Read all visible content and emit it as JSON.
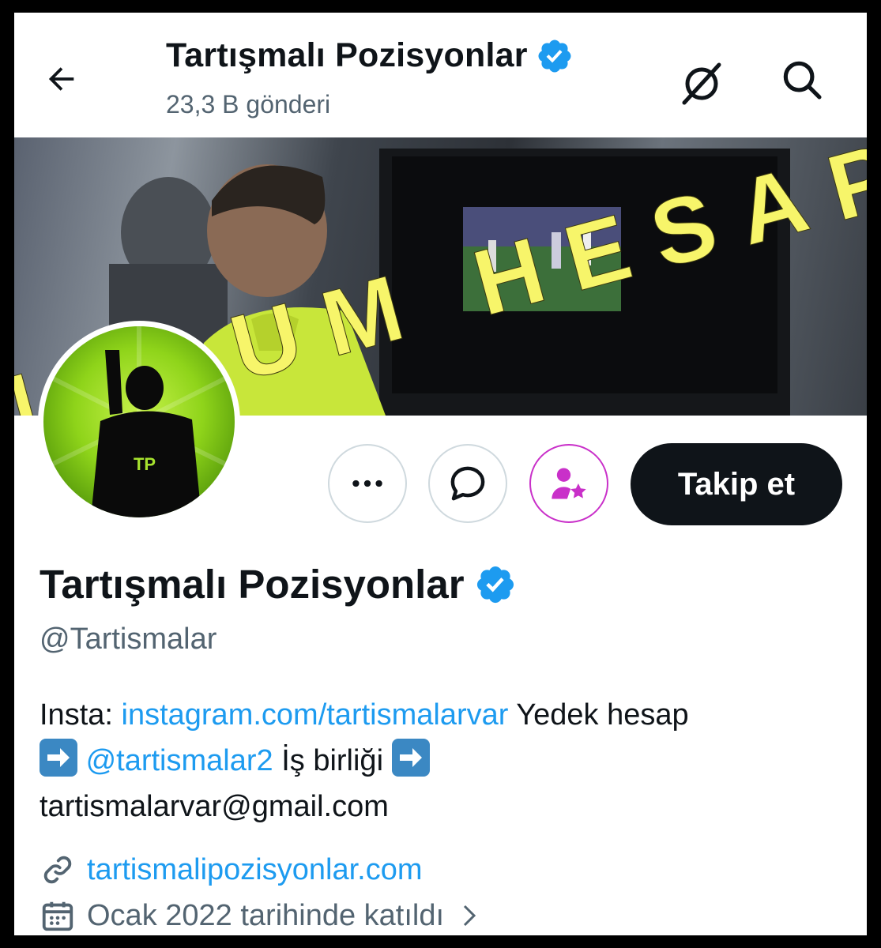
{
  "header": {
    "title": "Tartışmalı Pozisyonlar",
    "post_count": "23,3 B gönderi",
    "back_icon": "arrow-left-icon",
    "grok_icon": "grok-icon",
    "search_icon": "search-icon"
  },
  "banner": {
    "overlay_text": "MALUM HESAP",
    "overlay_color": "#f7f56a"
  },
  "avatar": {
    "logo_text": "TP"
  },
  "actions": {
    "more_icon": "more-icon",
    "message_icon": "message-icon",
    "subscribe_icon": "subscribe-icon",
    "follow_label": "Takip et"
  },
  "profile": {
    "name": "Tartışmalı Pozisyonlar",
    "verified_icon": "verified-badge-icon",
    "handle": "@Tartismalar",
    "bio": {
      "prefix": "Insta: ",
      "insta_link": "instagram.com/tartismalarvar",
      "mid1": " Yedek hesap",
      "backup_handle": "@tartismalar2",
      "mid2": " İş birliği ",
      "email": "tartismalarvar@gmail.com"
    },
    "website": "tartismalipozisyonlar.com",
    "joined": "Ocak 2022 tarihinde katıldı"
  },
  "colors": {
    "accent": "#1d9bf0",
    "verified": "#1d9bf0",
    "subscribe": "#c930c9",
    "text_primary": "#0f1419",
    "text_secondary": "#536471"
  }
}
